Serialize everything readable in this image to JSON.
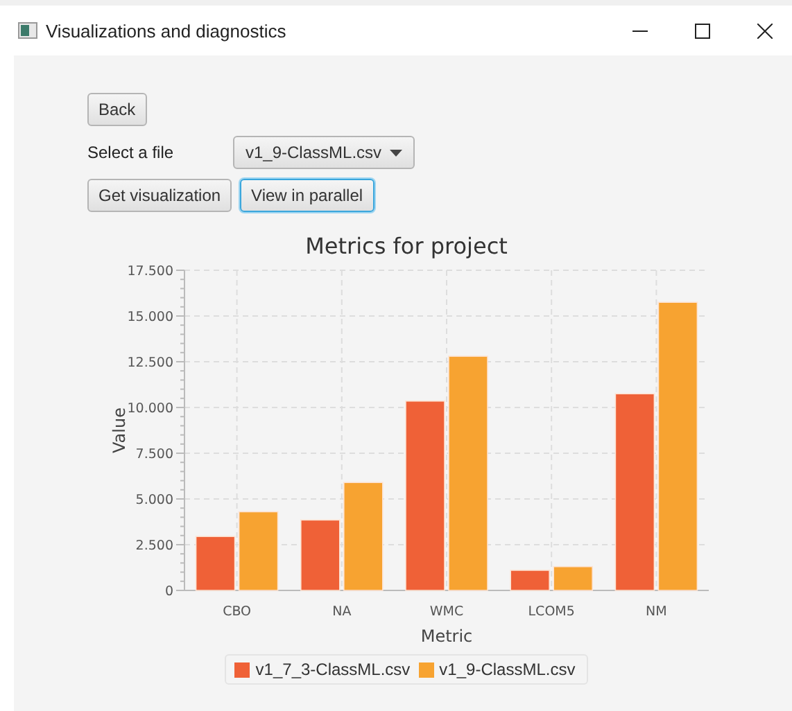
{
  "window": {
    "title": "Visualizations and diagnostics"
  },
  "back_button": "Back",
  "file_select": {
    "label": "Select a file",
    "value": "v1_9-ClassML.csv"
  },
  "buttons": [
    {
      "label": "Get visualization",
      "focused": false
    },
    {
      "label": "View in parallel",
      "focused": true
    }
  ],
  "chart_data": {
    "type": "bar",
    "title": "Metrics for project",
    "xlabel": "Metric",
    "ylabel": "Value",
    "categories": [
      "CBO",
      "NA",
      "WMC",
      "LCOM5",
      "NM"
    ],
    "series": [
      {
        "name": "v1_7_3-ClassML.csv",
        "color": "#ef6137",
        "values": [
          2950,
          3850,
          10350,
          1100,
          10750
        ]
      },
      {
        "name": "v1_9-ClassML.csv",
        "color": "#f7a331",
        "values": [
          4300,
          5900,
          12800,
          1300,
          15750
        ]
      }
    ],
    "ylim": [
      0,
      17500
    ],
    "grid": true,
    "yticks": [
      {
        "value": 0,
        "label": "0"
      },
      {
        "value": 2500,
        "label": "2.500"
      },
      {
        "value": 5000,
        "label": "5.000"
      },
      {
        "value": 7500,
        "label": "7.500"
      },
      {
        "value": 10000,
        "label": "10.000"
      },
      {
        "value": 12500,
        "label": "12.500"
      },
      {
        "value": 15000,
        "label": "15.000"
      },
      {
        "value": 17500,
        "label": "17.500"
      }
    ]
  }
}
